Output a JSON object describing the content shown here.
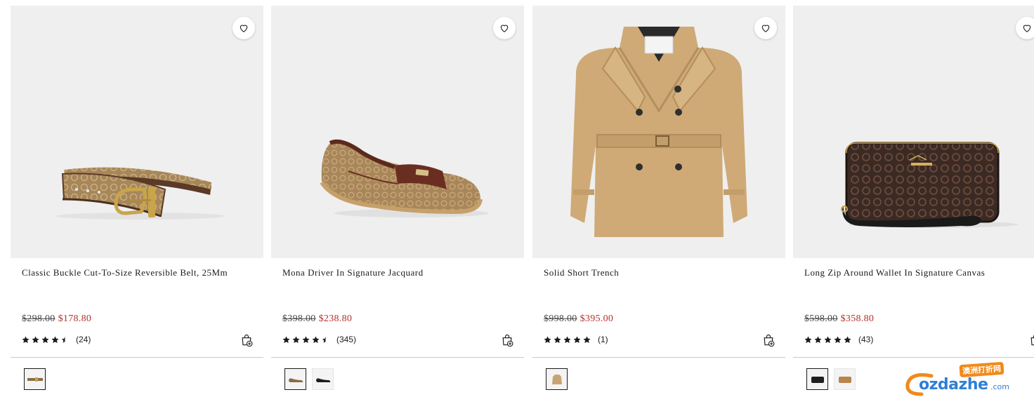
{
  "colors": {
    "sale_price": "#b4312d",
    "tile_background": "#efefef",
    "divider": "#c9c9c9"
  },
  "products": [
    {
      "name": "Classic Buckle Cut-To-Size Reversible Belt, 25Mm",
      "original_price": "$298.00",
      "sale_price": "$178.80",
      "rating": 4.5,
      "review_count": "(24)",
      "image_icon": "belt-image",
      "swatches": [
        {
          "name": "khaki-signature",
          "selected": true
        }
      ]
    },
    {
      "name": "Mona Driver In Signature Jacquard",
      "original_price": "$398.00",
      "sale_price": "$238.80",
      "rating": 4.5,
      "review_count": "(345)",
      "image_icon": "loafer-image",
      "swatches": [
        {
          "name": "khaki-signature",
          "selected": true
        },
        {
          "name": "black",
          "selected": false
        }
      ]
    },
    {
      "name": "Solid Short Trench",
      "original_price": "$998.00",
      "sale_price": "$395.00",
      "rating": 5,
      "review_count": "(1)",
      "image_icon": "trench-coat-image",
      "swatches": [
        {
          "name": "tan",
          "selected": true
        }
      ]
    },
    {
      "name": "Long Zip Around Wallet In Signature Canvas",
      "original_price": "$598.00",
      "sale_price": "$358.80",
      "rating": 5,
      "review_count": "(43)",
      "image_icon": "wallet-image",
      "swatches": [
        {
          "name": "brown-black",
          "selected": true
        },
        {
          "name": "tan",
          "selected": false
        }
      ]
    }
  ],
  "watermark": {
    "badge": "澳洲打折网",
    "logo_text": "ozdazhe",
    "suffix": ".com"
  }
}
